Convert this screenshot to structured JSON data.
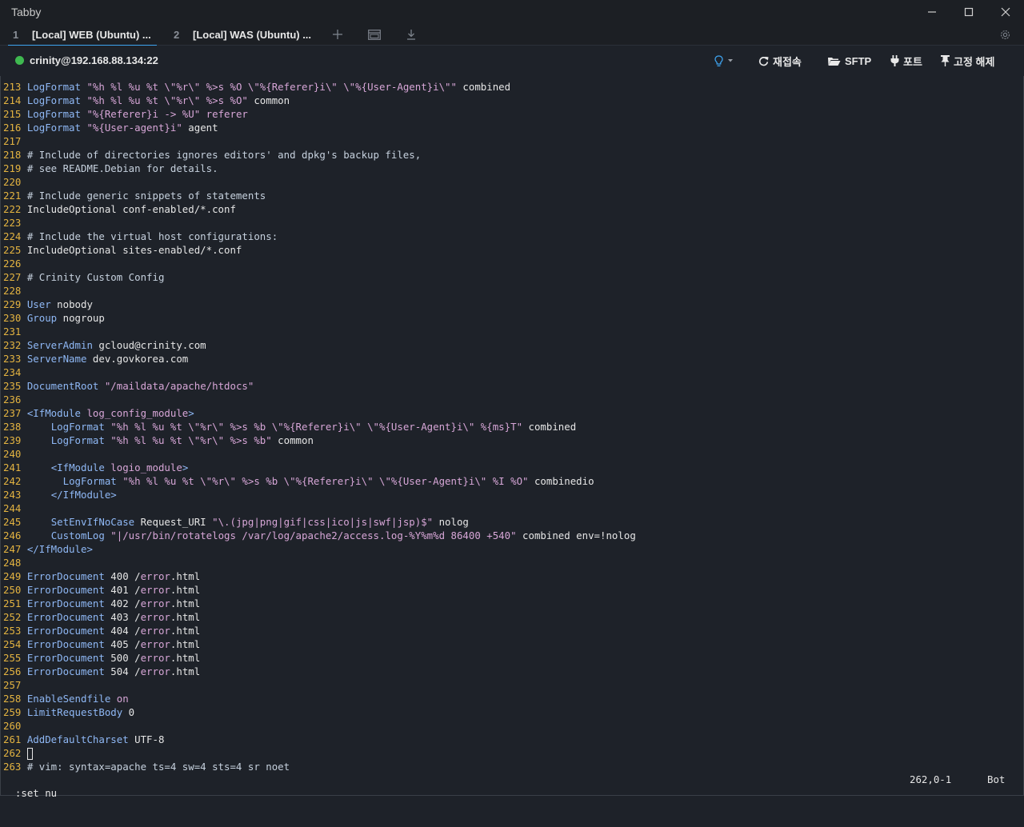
{
  "app": {
    "title": "Tabby"
  },
  "window_controls": {
    "minimize_icon": "minimize-icon",
    "maximize_icon": "maximize-icon",
    "close_icon": "close-icon"
  },
  "tabs": [
    {
      "number": "1",
      "label": "[Local] WEB (Ubuntu) ...",
      "active": true
    },
    {
      "number": "2",
      "label": "[Local] WAS (Ubuntu) ...",
      "active": false
    }
  ],
  "tabbar_icons": [
    "plus-icon",
    "split-window-icon",
    "download-icon",
    "settings-icon"
  ],
  "connection": {
    "host": "crinity@192.168.88.134:22",
    "status_color": "#3fb950"
  },
  "toolbar": {
    "reconnect_label": "재접속",
    "sftp_label": "SFTP",
    "ports_label": "포트",
    "unpin_label": "고정 해제"
  },
  "terminal": {
    "lines": [
      {
        "n": "213",
        "parts": [
          [
            "kw",
            "LogFormat"
          ],
          [
            "t",
            " "
          ],
          [
            "str",
            "\"%h %l %u %t \\\"%r\\\" %>s %O \\\"%{Referer}i\\\" \\\"%{User-Agent}i\\\"\""
          ],
          [
            "t",
            " combined"
          ]
        ]
      },
      {
        "n": "214",
        "parts": [
          [
            "kw",
            "LogFormat"
          ],
          [
            "t",
            " "
          ],
          [
            "str",
            "\"%h %l %u %t \\\"%r\\\" %>s %O\""
          ],
          [
            "t",
            " common"
          ]
        ]
      },
      {
        "n": "215",
        "parts": [
          [
            "kw",
            "LogFormat"
          ],
          [
            "t",
            " "
          ],
          [
            "str",
            "\"%{Referer}i -> %U\""
          ],
          [
            "str",
            " referer"
          ]
        ]
      },
      {
        "n": "216",
        "parts": [
          [
            "kw",
            "LogFormat"
          ],
          [
            "t",
            " "
          ],
          [
            "str",
            "\"%{User-agent}i\""
          ],
          [
            "t",
            " agent"
          ]
        ]
      },
      {
        "n": "217",
        "parts": []
      },
      {
        "n": "218",
        "parts": [
          [
            "cm",
            "# Include of directories ignores editors' and dpkg's backup files,"
          ]
        ]
      },
      {
        "n": "219",
        "parts": [
          [
            "cm",
            "# see README.Debian for details."
          ]
        ]
      },
      {
        "n": "220",
        "parts": []
      },
      {
        "n": "221",
        "parts": [
          [
            "cm",
            "# Include generic snippets of statements"
          ]
        ]
      },
      {
        "n": "222",
        "parts": [
          [
            "t",
            "IncludeOptional conf-enabled/*.conf"
          ]
        ]
      },
      {
        "n": "223",
        "parts": []
      },
      {
        "n": "224",
        "parts": [
          [
            "cm",
            "# Include the virtual host configurations:"
          ]
        ]
      },
      {
        "n": "225",
        "parts": [
          [
            "t",
            "IncludeOptional sites-enabled/*.conf"
          ]
        ]
      },
      {
        "n": "226",
        "parts": []
      },
      {
        "n": "227",
        "parts": [
          [
            "cm",
            "# Crinity Custom Config"
          ]
        ]
      },
      {
        "n": "228",
        "parts": []
      },
      {
        "n": "229",
        "parts": [
          [
            "kw",
            "User"
          ],
          [
            "t",
            " nobody"
          ]
        ]
      },
      {
        "n": "230",
        "parts": [
          [
            "kw",
            "Group"
          ],
          [
            "t",
            " nogroup"
          ]
        ]
      },
      {
        "n": "231",
        "parts": []
      },
      {
        "n": "232",
        "parts": [
          [
            "kw",
            "ServerAdmin"
          ],
          [
            "t",
            " gcloud@crinity.com"
          ]
        ]
      },
      {
        "n": "233",
        "parts": [
          [
            "kw",
            "ServerName"
          ],
          [
            "t",
            " dev.govkorea.com"
          ]
        ]
      },
      {
        "n": "234",
        "parts": []
      },
      {
        "n": "235",
        "parts": [
          [
            "kw",
            "DocumentRoot"
          ],
          [
            "t",
            " "
          ],
          [
            "str",
            "\"/maildata/apache/htdocs\""
          ]
        ]
      },
      {
        "n": "236",
        "parts": []
      },
      {
        "n": "237",
        "parts": [
          [
            "kw",
            "<IfModule"
          ],
          [
            "str",
            " log_config_module"
          ],
          [
            "kw",
            ">"
          ]
        ]
      },
      {
        "n": "238",
        "parts": [
          [
            "t",
            "    "
          ],
          [
            "kw",
            "LogFormat"
          ],
          [
            "t",
            " "
          ],
          [
            "str",
            "\"%h %l %u %t \\\"%r\\\" %>s %b \\\"%{Referer}i\\\" \\\"%{User-Agent}i\\\" %{ms}T\""
          ],
          [
            "t",
            " combined"
          ]
        ]
      },
      {
        "n": "239",
        "parts": [
          [
            "t",
            "    "
          ],
          [
            "kw",
            "LogFormat"
          ],
          [
            "t",
            " "
          ],
          [
            "str",
            "\"%h %l %u %t \\\"%r\\\" %>s %b\""
          ],
          [
            "t",
            " common"
          ]
        ]
      },
      {
        "n": "240",
        "parts": []
      },
      {
        "n": "241",
        "parts": [
          [
            "t",
            "    "
          ],
          [
            "kw",
            "<IfModule"
          ],
          [
            "str",
            " logio_module"
          ],
          [
            "kw",
            ">"
          ]
        ]
      },
      {
        "n": "242",
        "parts": [
          [
            "t",
            "      "
          ],
          [
            "kw",
            "LogFormat"
          ],
          [
            "t",
            " "
          ],
          [
            "str",
            "\"%h %l %u %t \\\"%r\\\" %>s %b \\\"%{Referer}i\\\" \\\"%{User-Agent}i\\\" %I %O\""
          ],
          [
            "t",
            " combinedio"
          ]
        ]
      },
      {
        "n": "243",
        "parts": [
          [
            "t",
            "    "
          ],
          [
            "kw",
            "</IfModule>"
          ]
        ]
      },
      {
        "n": "244",
        "parts": []
      },
      {
        "n": "245",
        "parts": [
          [
            "t",
            "    "
          ],
          [
            "kw",
            "SetEnvIfNoCase"
          ],
          [
            "t",
            " Request_URI "
          ],
          [
            "str",
            "\"\\.(jpg|png|gif|css|ico|js|swf|jsp)$\""
          ],
          [
            "t",
            " nolog"
          ]
        ]
      },
      {
        "n": "246",
        "parts": [
          [
            "t",
            "    "
          ],
          [
            "kw",
            "CustomLog"
          ],
          [
            "t",
            " "
          ],
          [
            "str",
            "\"|/usr/bin/rotatelogs /var/log/apache2/access.log-%Y%m%d 86400 +540\""
          ],
          [
            "t",
            " combined env=!nolog"
          ]
        ]
      },
      {
        "n": "247",
        "parts": [
          [
            "kw",
            "</IfModule>"
          ]
        ]
      },
      {
        "n": "248",
        "parts": []
      },
      {
        "n": "249",
        "parts": [
          [
            "kw",
            "ErrorDocument"
          ],
          [
            "t",
            " 400 /"
          ],
          [
            "str",
            "error"
          ],
          [
            "t",
            ".html"
          ]
        ]
      },
      {
        "n": "250",
        "parts": [
          [
            "kw",
            "ErrorDocument"
          ],
          [
            "t",
            " 401 /"
          ],
          [
            "str",
            "error"
          ],
          [
            "t",
            ".html"
          ]
        ]
      },
      {
        "n": "251",
        "parts": [
          [
            "kw",
            "ErrorDocument"
          ],
          [
            "t",
            " 402 /"
          ],
          [
            "str",
            "error"
          ],
          [
            "t",
            ".html"
          ]
        ]
      },
      {
        "n": "252",
        "parts": [
          [
            "kw",
            "ErrorDocument"
          ],
          [
            "t",
            " 403 /"
          ],
          [
            "str",
            "error"
          ],
          [
            "t",
            ".html"
          ]
        ]
      },
      {
        "n": "253",
        "parts": [
          [
            "kw",
            "ErrorDocument"
          ],
          [
            "t",
            " 404 /"
          ],
          [
            "str",
            "error"
          ],
          [
            "t",
            ".html"
          ]
        ]
      },
      {
        "n": "254",
        "parts": [
          [
            "kw",
            "ErrorDocument"
          ],
          [
            "t",
            " 405 /"
          ],
          [
            "str",
            "error"
          ],
          [
            "t",
            ".html"
          ]
        ]
      },
      {
        "n": "255",
        "parts": [
          [
            "kw",
            "ErrorDocument"
          ],
          [
            "t",
            " 500 /"
          ],
          [
            "str",
            "error"
          ],
          [
            "t",
            ".html"
          ]
        ]
      },
      {
        "n": "256",
        "parts": [
          [
            "kw",
            "ErrorDocument"
          ],
          [
            "t",
            " 504 /"
          ],
          [
            "str",
            "error"
          ],
          [
            "t",
            ".html"
          ]
        ]
      },
      {
        "n": "257",
        "parts": []
      },
      {
        "n": "258",
        "parts": [
          [
            "kw",
            "EnableSendfile"
          ],
          [
            "t",
            " "
          ],
          [
            "str",
            "on"
          ]
        ]
      },
      {
        "n": "259",
        "parts": [
          [
            "kw",
            "LimitRequestBody"
          ],
          [
            "t",
            " 0"
          ]
        ]
      },
      {
        "n": "260",
        "parts": []
      },
      {
        "n": "261",
        "parts": [
          [
            "kw",
            "AddDefaultCharset"
          ],
          [
            "t",
            " UTF-8"
          ]
        ]
      },
      {
        "n": "262",
        "parts": [
          [
            "cursor",
            ""
          ]
        ]
      },
      {
        "n": "263",
        "parts": [
          [
            "cm",
            "# vim: syntax=apache ts=4 sw=4 sts=4 sr noet"
          ]
        ]
      }
    ]
  },
  "statusline": {
    "command": ":set nu",
    "position": "262,0-1",
    "scroll": "Bot"
  }
}
